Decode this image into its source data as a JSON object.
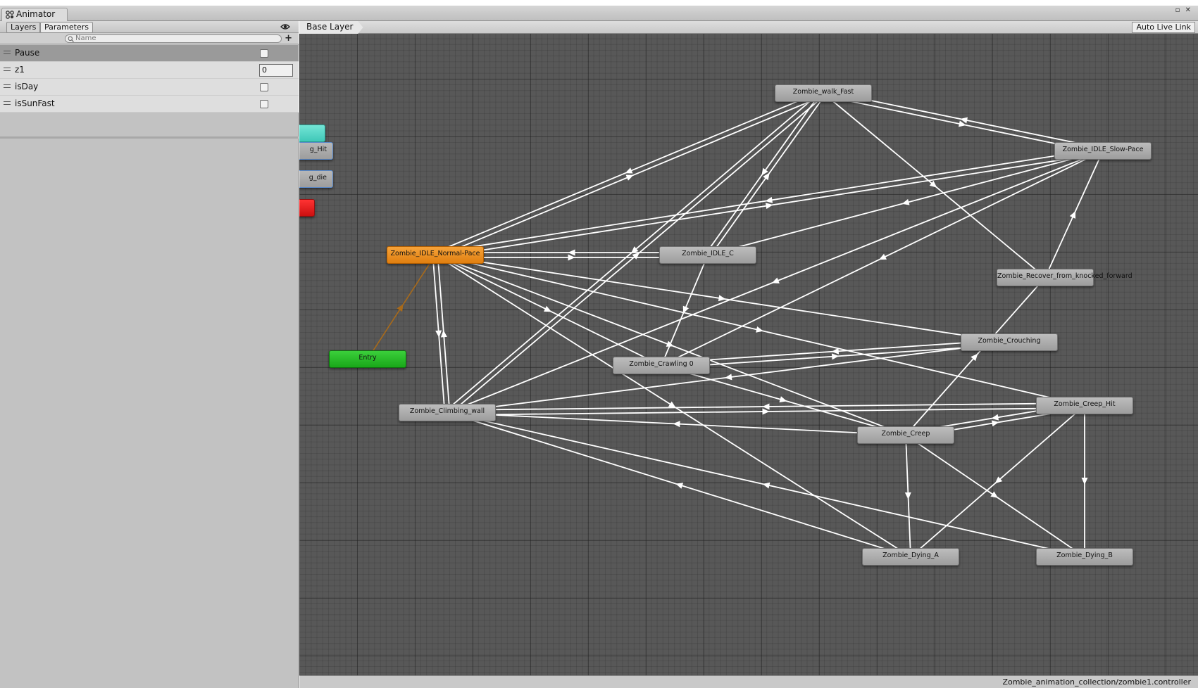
{
  "window": {
    "title": "Animator",
    "controls": "▫ ✕"
  },
  "left_panel": {
    "tabs": [
      "Layers",
      "Parameters"
    ],
    "search_placeholder": "Name",
    "add_button": "+",
    "parameters": [
      {
        "name": "Pause",
        "type": "bool",
        "value": false,
        "selected": true
      },
      {
        "name": "z1",
        "type": "int",
        "value": "0",
        "selected": false
      },
      {
        "name": "isDay",
        "type": "bool",
        "value": false,
        "selected": false
      },
      {
        "name": "isSunFast",
        "type": "bool",
        "value": false,
        "selected": false
      }
    ]
  },
  "graph": {
    "breadcrumb": "Base Layer",
    "auto_live_link": "Auto Live Link",
    "status_path": "Zombie_animation_collection/zombie1.controller",
    "colors": {
      "transition": "#ffffff",
      "entry_transition": "#a86a1a",
      "default_state": "#f08f1e",
      "entry": "#22b822"
    },
    "partial_nodes": [
      {
        "label": "",
        "style": "partial-cyan"
      },
      {
        "label": "g_Hit",
        "style": "partial-blue"
      },
      {
        "label": "g_die",
        "style": "partial-blue"
      },
      {
        "label": "",
        "style": "partial-red"
      }
    ],
    "states": [
      {
        "id": "walk_fast",
        "label": "Zombie_walk_Fast"
      },
      {
        "id": "idle_slow",
        "label": "Zombie_IDLE_Slow-Pace"
      },
      {
        "id": "idle_normal",
        "label": "Zombie_IDLE_Normal-Pace",
        "default": true
      },
      {
        "id": "idle_c",
        "label": "Zombie_IDLE_C"
      },
      {
        "id": "recover",
        "label": "Zombie_Recover_from_knocked_forward"
      },
      {
        "id": "entry",
        "label": "Entry",
        "entry": true
      },
      {
        "id": "crouching",
        "label": "Zombie_Crouching"
      },
      {
        "id": "crawling",
        "label": "Zombie_Crawling 0"
      },
      {
        "id": "climbing",
        "label": "Zombie_Climbing_wall"
      },
      {
        "id": "creep_hit",
        "label": "Zombie_Creep_Hit"
      },
      {
        "id": "creep",
        "label": "Zombie_Creep"
      },
      {
        "id": "dying_a",
        "label": "Zombie_Dying_A"
      },
      {
        "id": "dying_b",
        "label": "Zombie_Dying_B"
      }
    ],
    "transitions": [
      [
        "entry",
        "idle_normal"
      ],
      [
        "walk_fast",
        "idle_normal"
      ],
      [
        "idle_normal",
        "walk_fast"
      ],
      [
        "walk_fast",
        "idle_slow"
      ],
      [
        "idle_slow",
        "walk_fast"
      ],
      [
        "walk_fast",
        "climbing"
      ],
      [
        "climbing",
        "walk_fast"
      ],
      [
        "walk_fast",
        "idle_c"
      ],
      [
        "idle_c",
        "walk_fast"
      ],
      [
        "walk_fast",
        "recover"
      ],
      [
        "idle_slow",
        "idle_normal"
      ],
      [
        "idle_normal",
        "idle_slow"
      ],
      [
        "idle_slow",
        "climbing"
      ],
      [
        "idle_slow",
        "crawling"
      ],
      [
        "idle_slow",
        "idle_c"
      ],
      [
        "recover",
        "idle_slow"
      ],
      [
        "idle_normal",
        "idle_c"
      ],
      [
        "idle_c",
        "idle_normal"
      ],
      [
        "idle_c",
        "crawling"
      ],
      [
        "idle_normal",
        "climbing"
      ],
      [
        "climbing",
        "idle_normal"
      ],
      [
        "idle_normal",
        "crouching"
      ],
      [
        "idle_normal",
        "creep_hit"
      ],
      [
        "idle_normal",
        "creep"
      ],
      [
        "idle_normal",
        "crawling"
      ],
      [
        "idle_normal",
        "dying_a"
      ],
      [
        "crouching",
        "crawling"
      ],
      [
        "crawling",
        "crouching"
      ],
      [
        "crouching",
        "climbing"
      ],
      [
        "creep",
        "recover"
      ],
      [
        "crawling",
        "creep"
      ],
      [
        "climbing",
        "creep_hit"
      ],
      [
        "creep_hit",
        "climbing"
      ],
      [
        "creep",
        "climbing"
      ],
      [
        "creep",
        "creep_hit"
      ],
      [
        "creep_hit",
        "creep"
      ],
      [
        "creep",
        "dying_a"
      ],
      [
        "creep",
        "dying_b"
      ],
      [
        "creep_hit",
        "dying_b"
      ],
      [
        "creep_hit",
        "dying_a"
      ],
      [
        "dying_a",
        "climbing"
      ],
      [
        "dying_b",
        "climbing"
      ]
    ]
  }
}
